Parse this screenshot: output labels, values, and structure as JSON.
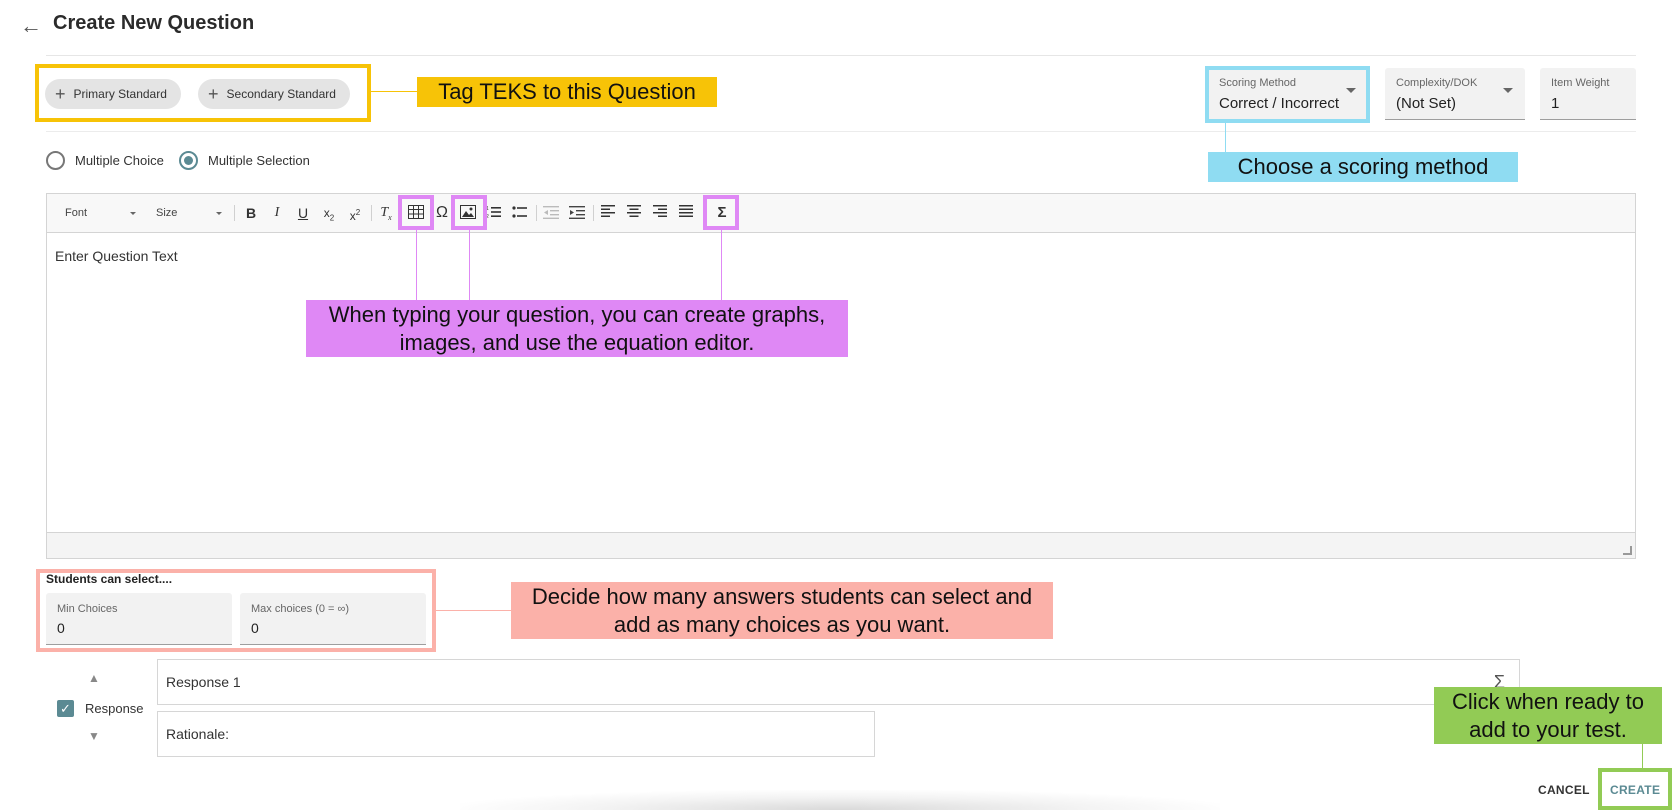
{
  "header": {
    "title": "Create New Question"
  },
  "standards": {
    "primary_label": "Primary Standard",
    "secondary_label": "Secondary Standard"
  },
  "fields": {
    "scoring": {
      "label": "Scoring Method",
      "value": "Correct / Incorrect"
    },
    "complexity": {
      "label": "Complexity/DOK",
      "value": "(Not Set)"
    },
    "weight": {
      "label": "Item Weight",
      "value": "1"
    }
  },
  "question_type": {
    "options": [
      "Multiple Choice",
      "Multiple Selection"
    ],
    "selected": "Multiple Selection"
  },
  "editor": {
    "font_label": "Font",
    "size_label": "Size",
    "placeholder": "Enter Question Text",
    "omega": "Ω",
    "sigma": "Σ"
  },
  "students": {
    "title": "Students can select....",
    "min_label": "Min Choices",
    "min_value": "0",
    "max_label": "Max choices (0 = ∞)",
    "max_value": "0"
  },
  "response": {
    "checkbox_label": "Response",
    "checked": true,
    "response_text": "Response 1",
    "rationale_text": "Rationale:"
  },
  "actions": {
    "cancel": "CANCEL",
    "create": "CREATE"
  },
  "annotations": {
    "teks": "Tag TEKS to this Question",
    "scoring": "Choose a scoring method",
    "editor": "When typing your question, you can create graphs, images, and use the equation editor.",
    "choices": "Decide how many answers students can select and add as many choices as you want.",
    "create": "Click when ready to add to your test."
  },
  "colors": {
    "yellow": "#f7c307",
    "cyan": "#8fdcf2",
    "purple": "#df88f5",
    "pink": "#fbb1a9",
    "green": "#92cb55",
    "accent": "#5b8a93"
  }
}
